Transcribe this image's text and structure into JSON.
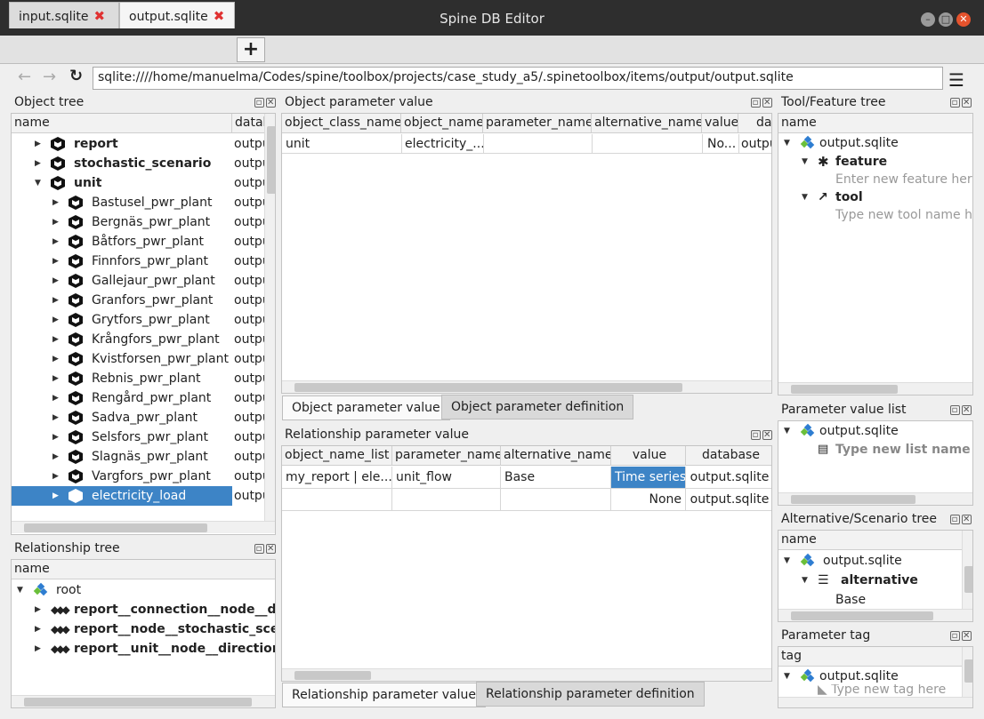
{
  "window": {
    "title": "Spine DB Editor"
  },
  "tabs": [
    {
      "label": "input.sqlite"
    },
    {
      "label": "output.sqlite"
    }
  ],
  "add_tab_label": "+",
  "url": "sqlite:////home/manuelma/Codes/spine/toolbox/projects/case_study_a5/.spinetoolbox/items/output/output.sqlite",
  "object_tree": {
    "title": "Object tree",
    "headers": [
      "name",
      "datab"
    ],
    "rows": [
      {
        "name": "report",
        "db": "outpu"
      },
      {
        "name": "stochastic_scenario",
        "db": "outpu"
      },
      {
        "name": "unit",
        "db": "outpu"
      },
      {
        "name": "Bastusel_pwr_plant",
        "db": "outpu"
      },
      {
        "name": "Bergnäs_pwr_plant",
        "db": "outpu"
      },
      {
        "name": "Båtfors_pwr_plant",
        "db": "outpu"
      },
      {
        "name": "Finnfors_pwr_plant",
        "db": "outpu"
      },
      {
        "name": "Gallejaur_pwr_plant",
        "db": "outpu"
      },
      {
        "name": "Granfors_pwr_plant",
        "db": "outpu"
      },
      {
        "name": "Grytfors_pwr_plant",
        "db": "outpu"
      },
      {
        "name": "Krångfors_pwr_plant",
        "db": "outpu"
      },
      {
        "name": "Kvistforsen_pwr_plant",
        "db": "outpu"
      },
      {
        "name": "Rebnis_pwr_plant",
        "db": "outpu"
      },
      {
        "name": "Rengård_pwr_plant",
        "db": "outpu"
      },
      {
        "name": "Sadva_pwr_plant",
        "db": "outpu"
      },
      {
        "name": "Selsfors_pwr_plant",
        "db": "outpu"
      },
      {
        "name": "Slagnäs_pwr_plant",
        "db": "outpu"
      },
      {
        "name": "Vargfors_pwr_plant",
        "db": "outpu"
      },
      {
        "name": "electricity_load",
        "db": "outpu"
      }
    ]
  },
  "relationship_tree": {
    "title": "Relationship tree",
    "header": "name",
    "root": "root",
    "rows": [
      "report__connection__node__dire",
      "report__node__stochastic_scenar",
      "report__unit__node__direction__"
    ]
  },
  "object_param_value": {
    "title": "Object parameter value",
    "headers": [
      "object_class_name",
      "object_name",
      "parameter_name",
      "alternative_name",
      "value",
      "dat"
    ],
    "row": [
      "unit",
      "electricity_...",
      "",
      "",
      "No...",
      "outpu"
    ],
    "tabs": [
      "Object parameter value",
      "Object parameter definition"
    ]
  },
  "relationship_param_value": {
    "title": "Relationship parameter value",
    "headers": [
      "object_name_list",
      "parameter_name",
      "alternative_name",
      "value",
      "database"
    ],
    "rows": [
      [
        "my_report | ele...",
        "unit_flow",
        "Base",
        "Time series",
        "output.sqlite"
      ],
      [
        "",
        "",
        "",
        "None",
        "output.sqlite"
      ]
    ],
    "tabs": [
      "Relationship parameter value",
      "Relationship parameter definition"
    ]
  },
  "tool_feature_tree": {
    "title": "Tool/Feature tree",
    "header": "name",
    "db": "output.sqlite",
    "feature": "feature",
    "feature_placeholder": "Enter new feature here.",
    "tool": "tool",
    "tool_placeholder": "Type new tool name he"
  },
  "param_value_list": {
    "title": "Parameter value list",
    "db": "output.sqlite",
    "placeholder": "Type new list name her"
  },
  "alt_scenario_tree": {
    "title": "Alternative/Scenario tree",
    "header": "name",
    "db": "output.sqlite",
    "alternative": "alternative",
    "base": "Base"
  },
  "param_tag": {
    "title": "Parameter tag",
    "header": "tag",
    "db": "output.sqlite",
    "placeholder": "Type new tag here"
  },
  "colors": {
    "selection": "#3d84c6",
    "tab_close": "#e03131",
    "titlebar": "#2e2e2e"
  }
}
